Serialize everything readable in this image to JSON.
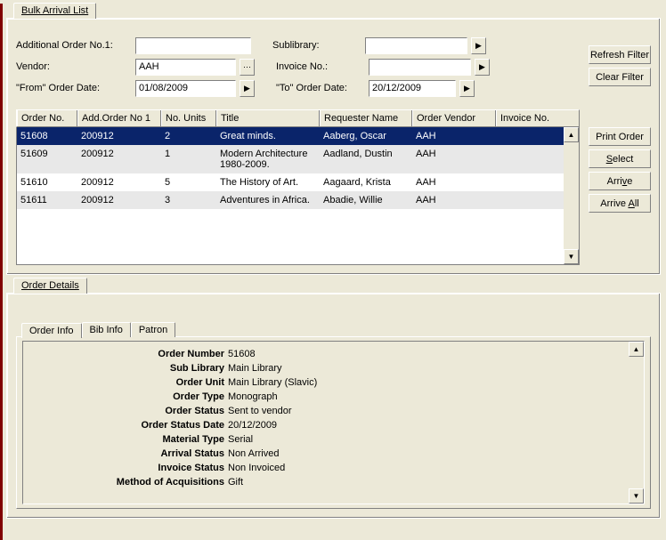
{
  "tabs": {
    "bulk_arrival": "Bulk Arrival List"
  },
  "filters": {
    "add_order_label": "Additional Order No.1:",
    "add_order_value": "",
    "sublibrary_label": "Sublibrary:",
    "sublibrary_value": "",
    "vendor_label": "Vendor:",
    "vendor_value": "AAH",
    "invoice_label": "Invoice No.:",
    "invoice_value": "",
    "from_date_label": "\"From\" Order Date:",
    "from_date_value": "01/08/2009",
    "to_date_label": "\"To\" Order Date:",
    "to_date_value": "20/12/2009"
  },
  "buttons": {
    "refresh": "Refresh Filter",
    "clear": "Clear Filter",
    "print": "Print Order",
    "select": "Select",
    "arrive": "Arrive",
    "arrive_all": "Arrive All"
  },
  "grid": {
    "headers": {
      "order_no": "Order No.",
      "add_order": "Add.Order No 1",
      "units": "No. Units",
      "title": "Title",
      "requester": "Requester Name",
      "vendor": "Order Vendor",
      "invoice": "Invoice No."
    },
    "cols": {
      "c0": 68,
      "c1": 94,
      "c2": 62,
      "c3": 116,
      "c4": 104,
      "c5": 94,
      "c6": 70
    },
    "rows": [
      {
        "order_no": "51608",
        "add_order": "200912",
        "units": "2",
        "title": "Great minds.",
        "requester": "Aaberg, Oscar",
        "vendor": "AAH",
        "invoice": ""
      },
      {
        "order_no": "51609",
        "add_order": "200912",
        "units": "1",
        "title": "Modern Architecture 1980-2009.",
        "requester": "Aadland, Dustin",
        "vendor": "AAH",
        "invoice": ""
      },
      {
        "order_no": "51610",
        "add_order": "200912",
        "units": "5",
        "title": "The History of Art.",
        "requester": "Aagaard, Krista",
        "vendor": "AAH",
        "invoice": ""
      },
      {
        "order_no": "51611",
        "add_order": "200912",
        "units": "3",
        "title": "Adventures in Africa.",
        "requester": "Abadie, Willie",
        "vendor": "AAH",
        "invoice": ""
      }
    ]
  },
  "details_tab": "Order Details",
  "inner_tabs": {
    "order_info": "Order Info",
    "bib_info": "Bib Info",
    "patron": "Patron"
  },
  "details": [
    {
      "k": "Order Number",
      "v": "51608"
    },
    {
      "k": "Sub Library",
      "v": "Main Library"
    },
    {
      "k": "Order Unit",
      "v": "Main Library (Slavic)"
    },
    {
      "k": "Order Type",
      "v": "Monograph"
    },
    {
      "k": "Order Status",
      "v": "Sent to vendor"
    },
    {
      "k": "Order Status Date",
      "v": "20/12/2009"
    },
    {
      "k": "Material Type",
      "v": "Serial"
    },
    {
      "k": "Arrival Status",
      "v": "Non Arrived"
    },
    {
      "k": "Invoice Status",
      "v": "Non Invoiced"
    },
    {
      "k": "Method of Acquisitions",
      "v": "Gift"
    }
  ]
}
